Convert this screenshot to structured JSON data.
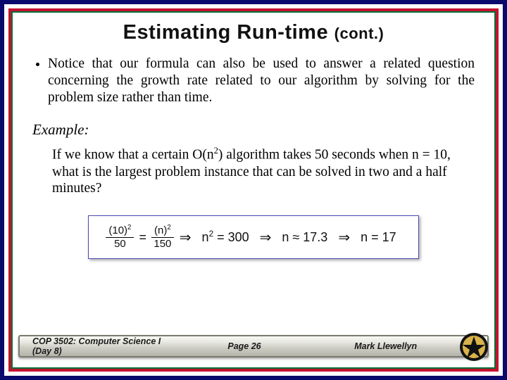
{
  "title_main": "Estimating Run-time",
  "title_cont": "(cont.)",
  "bullet1": "Notice that our formula can also be used to answer a related question concerning the growth rate related to our algorithm by solving for the problem size rather than time.",
  "example_label": "Example:",
  "example_pre": "If we know that a certain O(n",
  "example_sup": "2",
  "example_post": ") algorithm takes 50 seconds when n = 10, what is the largest problem instance that can be solved in two and a half minutes?",
  "eq": {
    "frac1_num_base": "(10)",
    "frac1_num_exp": "2",
    "frac1_den": "50",
    "equals": "=",
    "frac2_num_base": "(n)",
    "frac2_num_exp": "2",
    "frac2_den": "150",
    "implies": "⇒",
    "step2_lhs": "n",
    "step2_exp": "2",
    "step2_rest": " = 300",
    "step3": "n ≈ 17.3",
    "step4": "n = 17"
  },
  "footer": {
    "left_course": "COP 3502: Computer Science I",
    "left_day": "  (Day 8)",
    "center": "Page 26",
    "right": "Mark Llewellyn"
  }
}
